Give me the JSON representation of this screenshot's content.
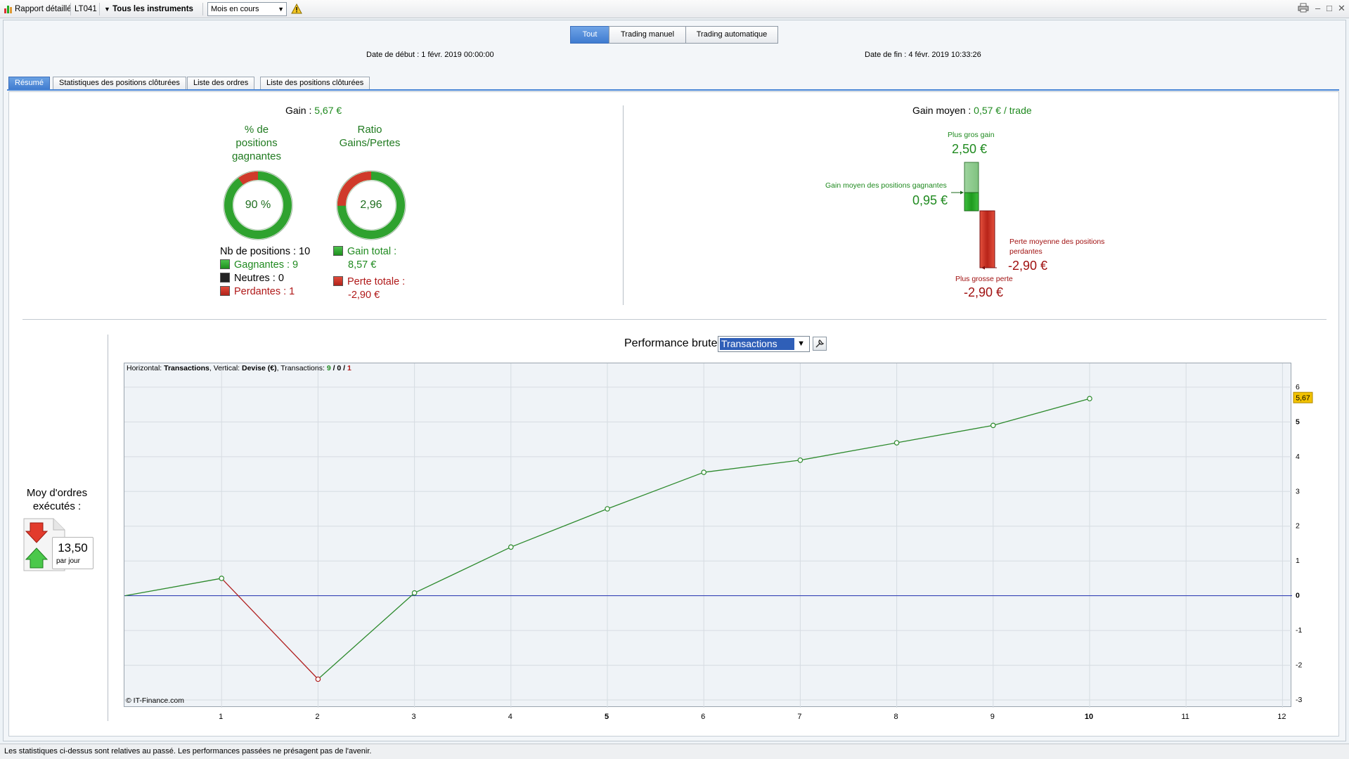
{
  "toolbar": {
    "report_label": "Rapport détaillé",
    "account": "LT041",
    "instruments": "Tous les instruments",
    "period": "Mois en cours",
    "warning_icon": "warning-icon",
    "print_icon": "print-icon"
  },
  "filters": {
    "tabs": [
      "Tout",
      "Trading manuel",
      "Trading automatique"
    ],
    "active": "Tout"
  },
  "dates": {
    "start": "Date de début : 1 févr. 2019 00:00:00",
    "end": "Date de fin : 4 févr. 2019 10:33:26"
  },
  "tabs": [
    "Résumé",
    "Statistiques des positions clôturées",
    "Liste des ordres",
    "Liste des positions clôturées"
  ],
  "summary": {
    "gain_label": "Gain : ",
    "gain_value": "5,67 €",
    "pct_title_1": "% de",
    "pct_title_2": "positions",
    "pct_title_3": "gagnantes",
    "ratio_title_1": "Ratio",
    "ratio_title_2": "Gains/Pertes",
    "pct_value": "90 %",
    "pct_fraction": 0.9,
    "ratio_value": "2,96",
    "ratio_fraction": 0.747,
    "nb_positions": "Nb de positions : 10",
    "gagnantes": "Gagnantes : 9",
    "neutres": "Neutres : 0",
    "perdantes": "Perdantes : 1",
    "gain_total_label": "Gain total :",
    "gain_total_value": "8,57 €",
    "perte_totale_label": "Perte totale :",
    "perte_totale_value": "-2,90 €"
  },
  "average": {
    "label": "Gain moyen : ",
    "value": "0,57 € / trade",
    "max_gain_label": "Plus gros gain",
    "max_gain_value": "2,50 €",
    "avg_win_label": "Gain moyen des positions gagnantes",
    "avg_win_value": "0,95 €",
    "avg_loss_label_1": "Perte moyenne des positions",
    "avg_loss_label_2": "perdantes",
    "avg_loss_value": "-2,90 €",
    "max_loss_label": "Plus grosse perte",
    "max_loss_value": "-2,90 €"
  },
  "orders": {
    "title_1": "Moy d'ordres",
    "title_2": "exécutés :",
    "value": "13,50",
    "unit": "par jour"
  },
  "performance": {
    "title": "Performance brute",
    "selector": "Transactions",
    "wrench_icon": "wrench-icon"
  },
  "chart_data": {
    "type": "line",
    "info_prefix": "Horizontal: ",
    "info_h": "Transactions",
    "info_mid": ", Vertical: ",
    "info_v": "Devise (€)",
    "info_tx": ", Transactions: ",
    "info_win": "9",
    "info_slash1": " / ",
    "info_neutral": "0",
    "info_slash2": " / ",
    "info_loss": "1",
    "copyright": "© IT-Finance.com",
    "x": [
      0,
      1,
      2,
      3,
      4,
      5,
      6,
      7,
      8,
      9,
      10
    ],
    "y": [
      0,
      0.5,
      -2.4,
      0.08,
      1.4,
      2.5,
      3.55,
      3.9,
      4.4,
      4.9,
      5.67
    ],
    "last_value_label": "5,67",
    "xlim": [
      0,
      12.1
    ],
    "ylim": [
      -3.1,
      6.2
    ],
    "x_ticks": [
      "1",
      "2",
      "3",
      "4",
      "5",
      "6",
      "7",
      "8",
      "9",
      "10",
      "11",
      "12"
    ],
    "y_ticks": [
      "6",
      "5",
      "4",
      "3",
      "2",
      "1",
      "0",
      "-1",
      "-2",
      "-3"
    ],
    "colors": {
      "up": "#2d8a2d",
      "down": "#b02020",
      "zero": "#2230b0",
      "grid": "#d6dce2"
    }
  },
  "footer": "Les statistiques ci-dessus sont relatives au passé. Les performances passées ne présagent pas de l'avenir."
}
